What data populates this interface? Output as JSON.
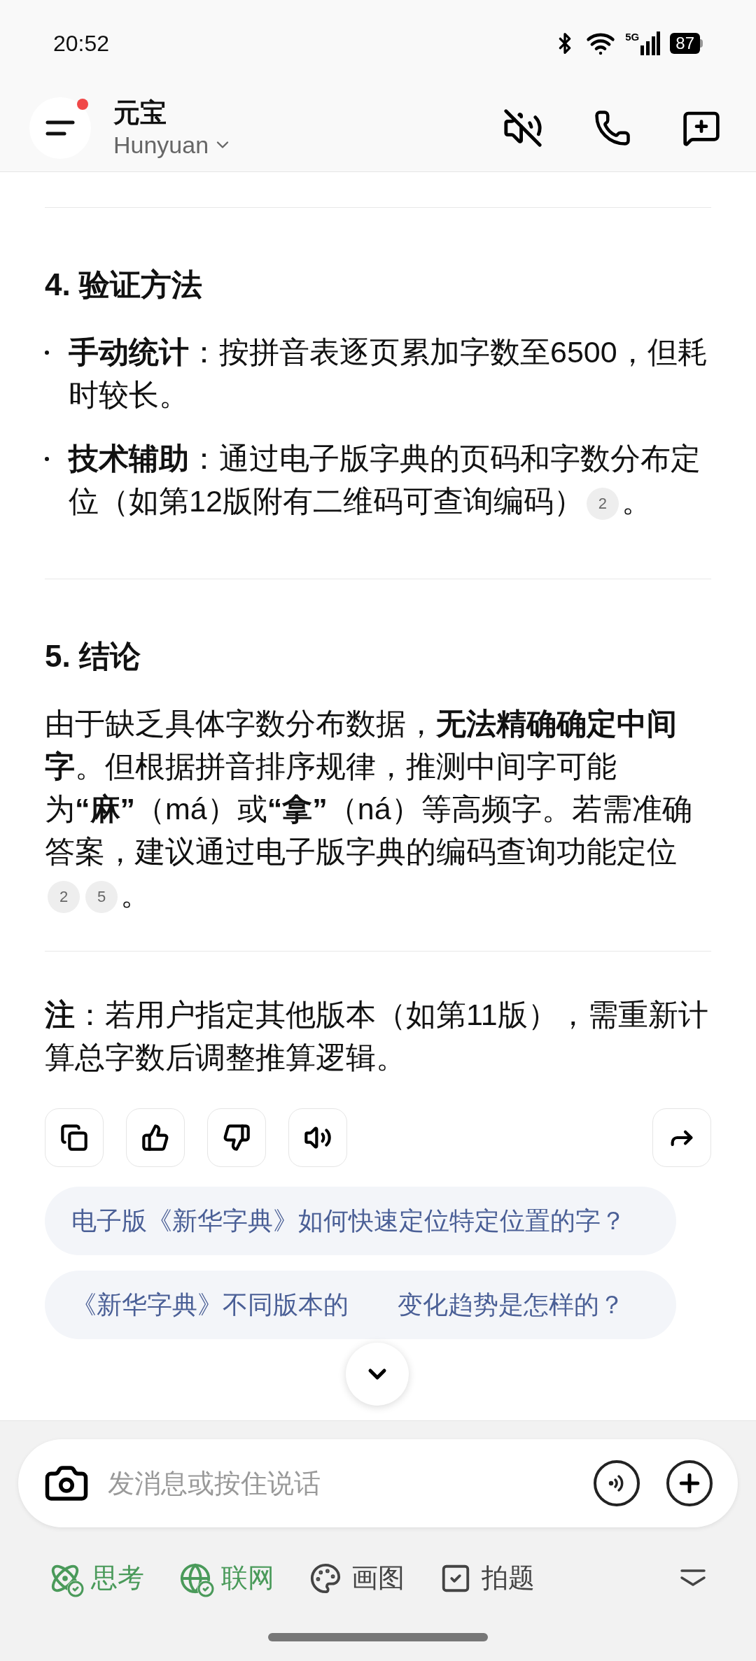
{
  "status_bar": {
    "time": "20:52",
    "network": "5G",
    "battery": "87"
  },
  "header": {
    "title": "元宝",
    "model": "Hunyuan",
    "menu_badge": true
  },
  "sections": [
    {
      "heading": "4. 验证方法",
      "bullets": [
        {
          "label": "手动统计",
          "text": "：按拼音表逐页累加字数至6500，但耗时较长。"
        },
        {
          "label": "技术辅助",
          "text": "：通过电子版字典的页码和字数分布定位（如第12版附有二维码可查询编码）",
          "refs": [
            "2"
          ],
          "tail": "。"
        }
      ]
    },
    {
      "heading": "5. 结论",
      "paragraphs": [
        {
          "text": "由于缺乏具体字数分布数据，**无法精确确定中间字**。但根据拼音排序规律，推测中间字可能为**“麻”**（má）或**“拿”**（ná）等高频字。若需准确答案，建议通过电子版字典的编码查询功能定位",
          "refs": [
            "2",
            "5"
          ],
          "tail": "。"
        }
      ]
    },
    {
      "paragraphs": [
        {
          "text": "**注**：若用户指定其他版本（如第11版），需重新计算总字数后调整推算逻辑。"
        }
      ]
    }
  ],
  "suggestions": [
    {
      "text_before": "电子版《新华字典》如何快速定位特定位置的字？"
    },
    {
      "text_before": "《新华字典》不同版本的",
      "text_after": "变化趋势是怎样的？"
    }
  ],
  "input": {
    "placeholder": "发消息或按住说话"
  },
  "tools": [
    {
      "kind": "think",
      "label": "思考",
      "on": true
    },
    {
      "kind": "web",
      "label": "联网",
      "on": true
    },
    {
      "kind": "draw",
      "label": "画图",
      "on": false
    },
    {
      "kind": "photo",
      "label": "拍题",
      "on": false
    }
  ]
}
